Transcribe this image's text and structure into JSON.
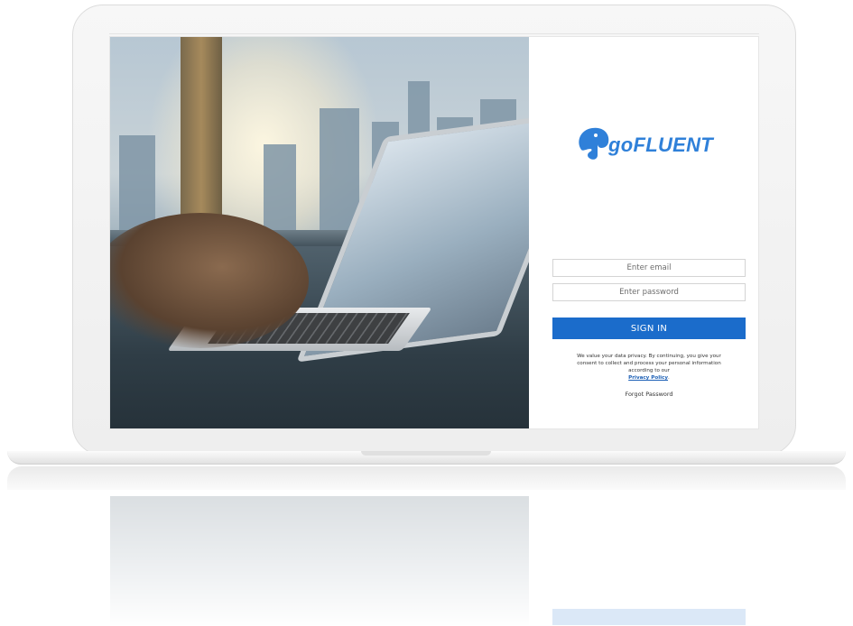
{
  "brand": {
    "logo_text": "goFLUENT",
    "logo_color": "#2f80d9"
  },
  "login": {
    "email_placeholder": "Enter email",
    "password_placeholder": "Enter password",
    "signin_label": "SIGN IN",
    "privacy_text": "We value your data privacy. By continuing, you give your consent to collect and process your personal information according to our",
    "privacy_link": "Privacy Policy",
    "privacy_period": ".",
    "forgot_label": "Forgot Password",
    "button_color": "#1b6ccb"
  },
  "photo": {
    "description_icon": "laptop-typing-image"
  }
}
